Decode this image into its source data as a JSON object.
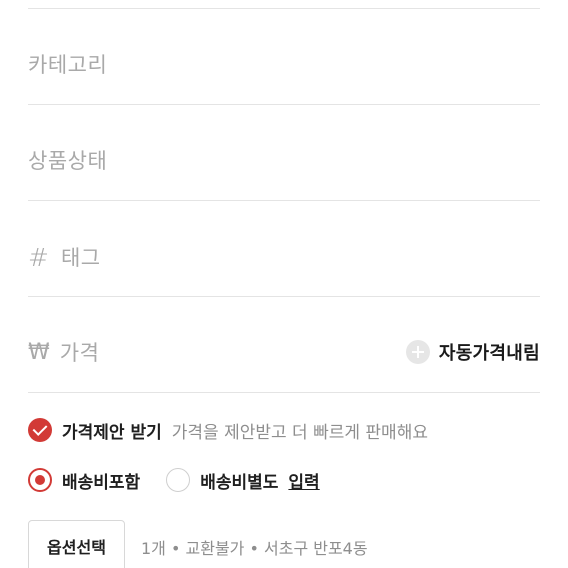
{
  "form": {
    "category_placeholder": "카테고리",
    "condition_placeholder": "상품상태",
    "tag_placeholder": "태그",
    "price_placeholder": "가격",
    "auto_price_label": "자동가격내림"
  },
  "icons": {
    "tag": "#",
    "price": "₩"
  },
  "offer": {
    "label": "가격제안 받기",
    "description": "가격을 제안받고 더 빠르게 판매해요",
    "checked": true
  },
  "shipping": {
    "included_label": "배송비포함",
    "separate_label": "배송비별도",
    "input_link": "입력",
    "selected": "included"
  },
  "options": {
    "button_label": "옵션선택",
    "summary": "1개 • 교환불가 • 서초구 반포4동"
  },
  "colors": {
    "accent": "#d23a36",
    "placeholder": "#a9a9a9",
    "divider": "#e4e4e4"
  }
}
